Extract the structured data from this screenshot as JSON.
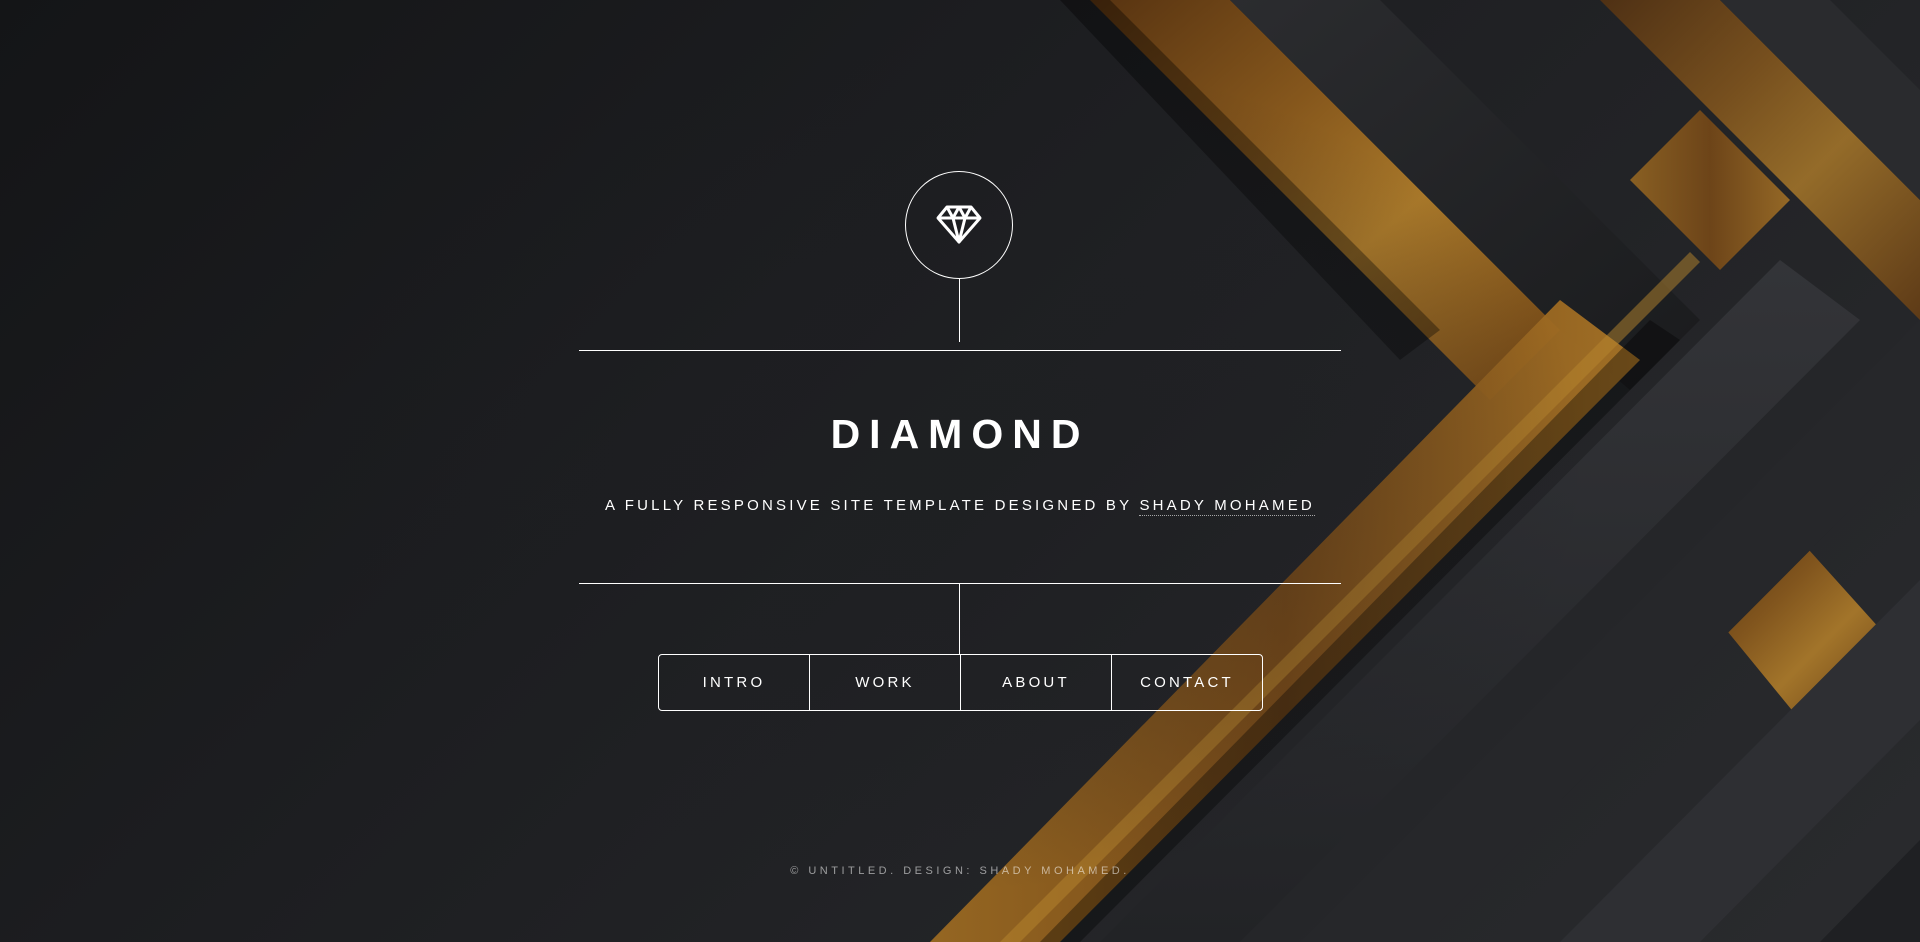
{
  "site": {
    "title": "DIAMOND",
    "tagline_prefix": "A FULLY RESPONSIVE SITE TEMPLATE DESIGNED BY ",
    "author_link": "SHADY MOHAMED",
    "logo_icon": "diamond-icon"
  },
  "nav": {
    "items": [
      {
        "label": "INTRO"
      },
      {
        "label": "WORK"
      },
      {
        "label": "ABOUT"
      },
      {
        "label": "CONTACT"
      }
    ]
  },
  "footer": {
    "text": "© UNTITLED. DESIGN: SHADY MOHAMED."
  },
  "colors": {
    "background": "#1c1d20",
    "accent_gold": "#a66f1d",
    "foreground": "#ffffff"
  }
}
